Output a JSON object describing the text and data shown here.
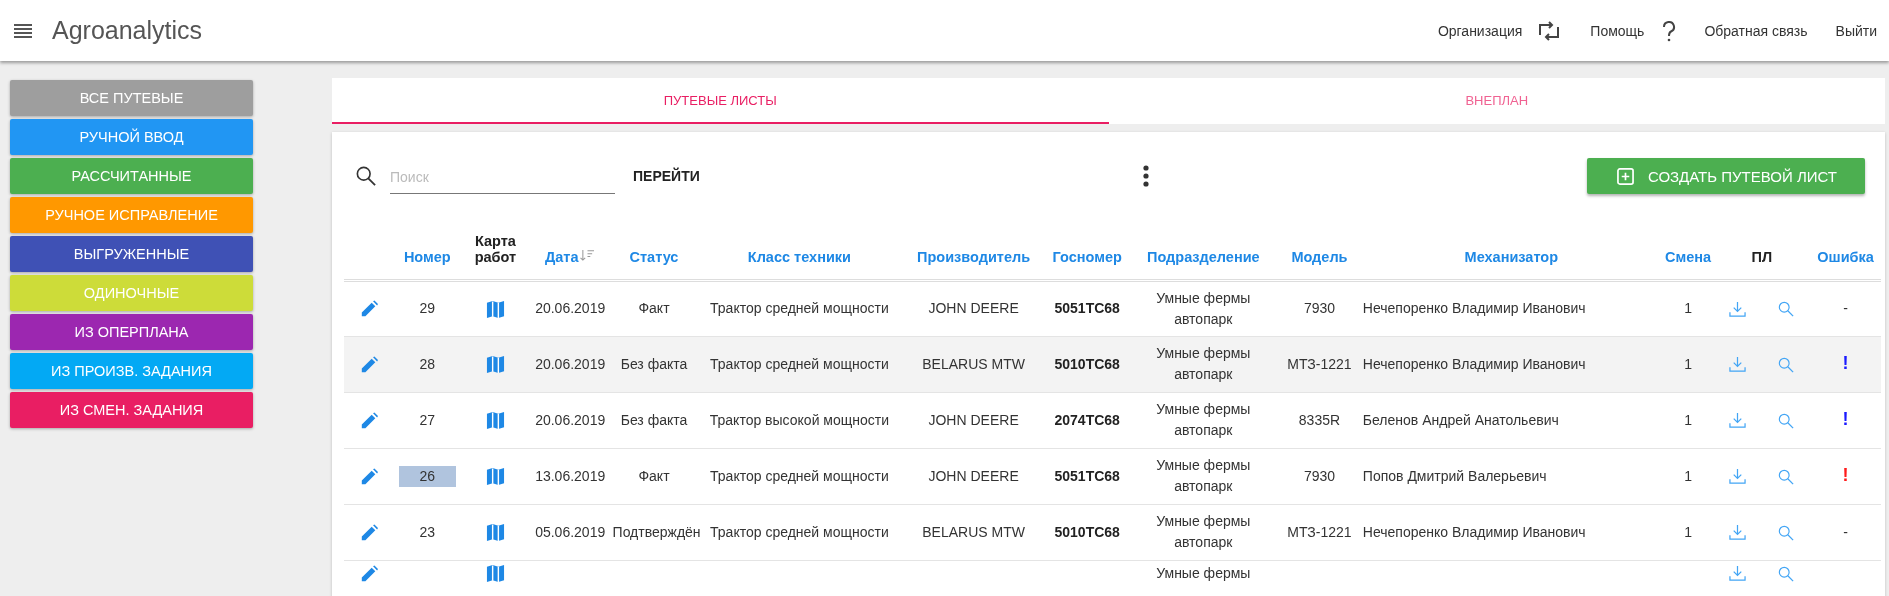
{
  "header": {
    "title": "Agroanalytics",
    "links": [
      {
        "label": "Организация"
      },
      {
        "label": "Помощь"
      },
      {
        "label": "Обратная связь"
      },
      {
        "label": "Выйти"
      }
    ]
  },
  "sidebar": {
    "items": [
      {
        "label": "ВСЕ ПУТЕВЫЕ",
        "color": "#9e9e9e"
      },
      {
        "label": "РУЧНОЙ ВВОД",
        "color": "#2196f3"
      },
      {
        "label": "РАССЧИТАННЫЕ",
        "color": "#4caf50"
      },
      {
        "label": "РУЧНОЕ ИСПРАВЛЕНИЕ",
        "color": "#ff9800"
      },
      {
        "label": "ВЫГРУЖЕННЫЕ",
        "color": "#3f51b5"
      },
      {
        "label": "ОДИНОЧНЫЕ",
        "color": "#cddc39"
      },
      {
        "label": "ИЗ ОПЕРПЛАНА",
        "color": "#9c27b0"
      },
      {
        "label": "ИЗ ПРОИЗВ. ЗАДАНИЯ",
        "color": "#03a9f4"
      },
      {
        "label": "ИЗ СМЕН. ЗАДАНИЯ",
        "color": "#e91e63"
      }
    ]
  },
  "tabs": [
    {
      "label": "ПУТЕВЫЕ ЛИСТЫ",
      "selected": true
    },
    {
      "label": "ВНЕПЛАН",
      "selected": false
    }
  ],
  "toolbar": {
    "search": {
      "placeholder": "Поиск"
    },
    "go_button": "ПЕРЕЙТИ",
    "create_button": "СОЗДАТЬ ПУТЕВОЙ ЛИСТ"
  },
  "table": {
    "columns": [
      {
        "label": "Номер",
        "kind": "sortable"
      },
      {
        "label": "Карта работ",
        "kind": "plain"
      },
      {
        "label": "Дата",
        "kind": "sortable",
        "sorted": true
      },
      {
        "label": "Статус",
        "kind": "sortable"
      },
      {
        "label": "Класс техники",
        "kind": "sortable"
      },
      {
        "label": "Производитель",
        "kind": "sortable"
      },
      {
        "label": "Госномер",
        "kind": "sortable"
      },
      {
        "label": "Подразделение",
        "kind": "sortable"
      },
      {
        "label": "Модель",
        "kind": "sortable"
      },
      {
        "label": "Механизатор",
        "kind": "sortable"
      },
      {
        "label": "Смена",
        "kind": "sortable"
      },
      {
        "label": "ПЛ",
        "kind": "plain"
      },
      {
        "label": "Ошибка",
        "kind": "sortable"
      }
    ],
    "rows": [
      {
        "number": "29",
        "date": "20.06.2019",
        "status": "Факт",
        "class": "Трактор средней мощности",
        "maker": "JOHN DEERE",
        "plate": "5051ТС68",
        "division": "Умные фермы автопарк",
        "model": "7930",
        "mechanic": "Нечепоренко Владимир Иванович",
        "shift": "1",
        "error": {
          "text": "-"
        },
        "hovered": false,
        "number_highlighted": false
      },
      {
        "number": "28",
        "date": "20.06.2019",
        "status": "Без факта",
        "class": "Трактор средней мощности",
        "maker": "BELARUS MTW",
        "plate": "5010ТС68",
        "division": "Умные фермы автопарк",
        "model": "МТЗ-1221",
        "mechanic": "Нечепоренко Владимир Иванович",
        "shift": "1",
        "error": {
          "text": "!",
          "color": "#1a1aff"
        },
        "hovered": true,
        "number_highlighted": false
      },
      {
        "number": "27",
        "date": "20.06.2019",
        "status": "Без факта",
        "class": "Трактор высокой мощности",
        "maker": "JOHN DEERE",
        "plate": "2074ТС68",
        "division": "Умные фермы автопарк",
        "model": "8335R",
        "mechanic": "Беленов Андрей Анатольевич",
        "shift": "1",
        "error": {
          "text": "!",
          "color": "#1a1aff"
        },
        "hovered": false,
        "number_highlighted": false
      },
      {
        "number": "26",
        "date": "13.06.2019",
        "status": "Факт",
        "class": "Трактор средней мощности",
        "maker": "JOHN DEERE",
        "plate": "5051ТС68",
        "division": "Умные фермы автопарк",
        "model": "7930",
        "mechanic": "Попов Дмитрий Валерьевич",
        "shift": "1",
        "error": {
          "text": "!",
          "color": "#ff1a1a"
        },
        "hovered": false,
        "number_highlighted": true
      },
      {
        "number": "23",
        "date": "05.06.2019",
        "status": "Подтверждён",
        "class": "Трактор средней мощности",
        "maker": "BELARUS MTW",
        "plate": "5010ТС68",
        "division": "Умные фермы автопарк",
        "model": "МТЗ-1221",
        "mechanic": "Нечепоренко Владимир Иванович",
        "shift": "1",
        "error": {
          "text": "-"
        },
        "hovered": false,
        "number_highlighted": false
      },
      {
        "division": "Умные фермы",
        "hovered": false
      }
    ]
  }
}
